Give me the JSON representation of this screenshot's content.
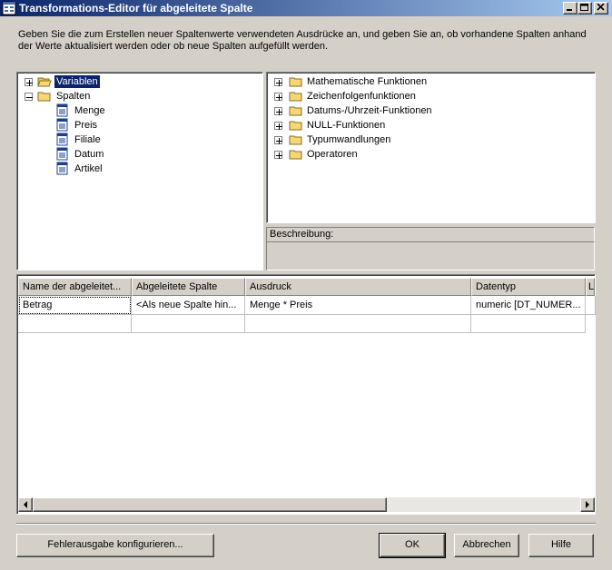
{
  "window": {
    "title": "Transformations-Editor für abgeleitete Spalte",
    "controls": {
      "minimize": "minimize-icon",
      "maximize": "maximize-icon",
      "close": "close-icon"
    }
  },
  "intro_text": "Geben Sie die zum Erstellen neuer Spaltenwerte verwendeten Ausdrücke an, und geben Sie an, ob vorhandene Spalten anhand der Werte aktualisiert werden oder ob neue Spalten aufgefüllt werden.",
  "left_tree": {
    "variables_label": "Variablen",
    "columns_label": "Spalten",
    "columns": [
      "Menge",
      "Preis",
      "Filiale",
      "Datum",
      "Artikel"
    ]
  },
  "function_tree": {
    "items": [
      "Mathematische Funktionen",
      "Zeichenfolgenfunktionen",
      "Datums-/Uhrzeit-Funktionen",
      "NULL-Funktionen",
      "Typumwandlungen",
      "Operatoren"
    ]
  },
  "description": {
    "label": "Beschreibung:"
  },
  "grid": {
    "columns": [
      "Name der abgeleitet...",
      "Abgeleitete Spalte",
      "Ausdruck",
      "Datentyp",
      "L"
    ],
    "rows": [
      [
        "Betrag",
        "<Als neue Spalte hin...",
        "Menge * Preis",
        "numeric [DT_NUMER...",
        ""
      ]
    ]
  },
  "buttons": {
    "error_output": "Fehlerausgabe konfigurieren...",
    "ok": "OK",
    "cancel": "Abbrechen",
    "help": "Hilfe"
  },
  "colors": {
    "selection": "#0a246a",
    "face": "#d4d0c8",
    "folder": "#f5d77a"
  }
}
